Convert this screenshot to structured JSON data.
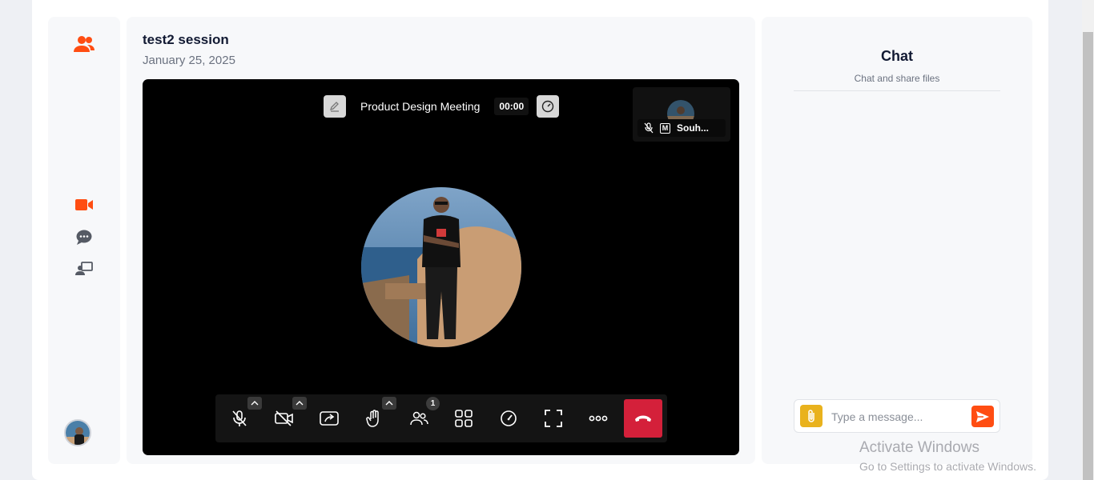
{
  "session": {
    "title": "test2 session",
    "date": "January 25, 2025"
  },
  "sidebar": {
    "icons": [
      "users-icon",
      "video-camera-icon",
      "chat-bubble-icon",
      "screen-share-icon"
    ],
    "accent": "#ff4d12"
  },
  "meeting": {
    "name": "Product Design Meeting",
    "timer": "00:00",
    "participant_thumb": {
      "name": "Souh...",
      "badge": "M"
    },
    "participants_count": "1",
    "toolbar": [
      "mic-muted-icon",
      "camera-off-icon",
      "share-screen-icon",
      "raise-hand-icon",
      "participants-icon",
      "grid-view-icon",
      "performance-icon",
      "fullscreen-icon",
      "more-icon",
      "hangup-icon"
    ],
    "hangup_color": "#d4203a"
  },
  "chat": {
    "title": "Chat",
    "subtitle": "Chat and share files",
    "placeholder": "Type a message...",
    "attach_color": "#e9b21d",
    "send_color": "#ff4d12"
  },
  "watermark": {
    "title": "Activate Windows",
    "subtitle": "Go to Settings to activate Windows."
  }
}
